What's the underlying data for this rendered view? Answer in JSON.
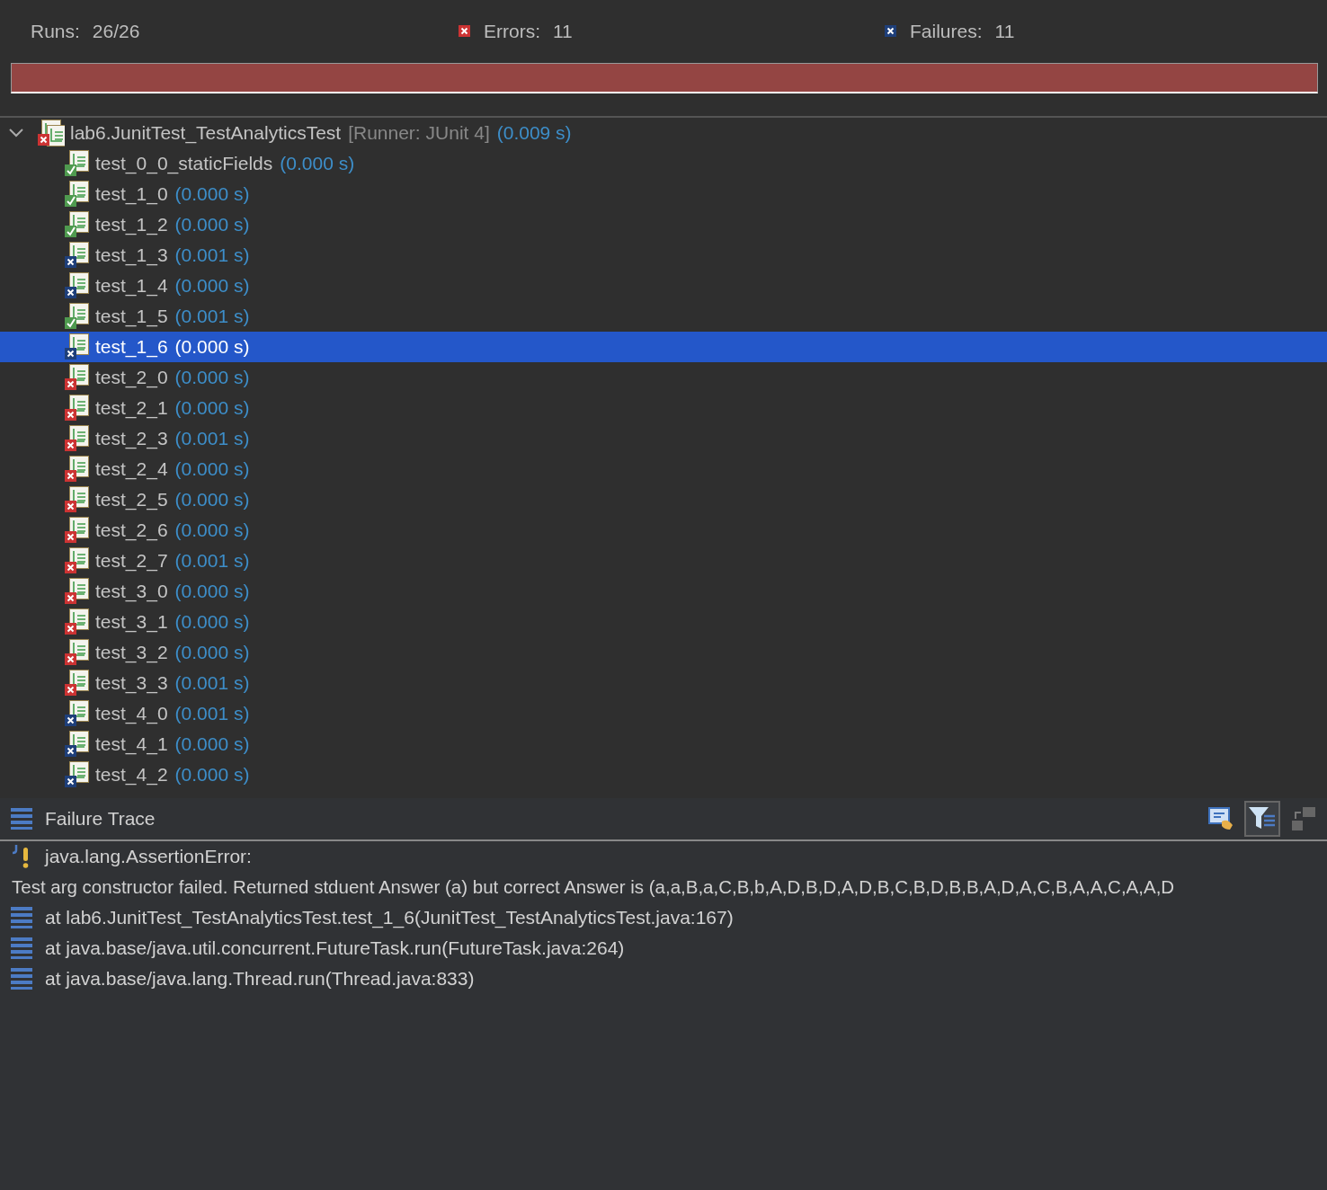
{
  "summary": {
    "runs_label": "Runs:",
    "runs": "26/26",
    "errors_label": "Errors:",
    "errors": "11",
    "failures_label": "Failures:",
    "failures": "11"
  },
  "progress": {
    "level": 1,
    "failed": true
  },
  "tree": {
    "suite": {
      "name": "lab6.JunitTest_TestAnalyticsTest",
      "runner": "[Runner: JUnit 4]",
      "time": "(0.009 s)",
      "kind": "error",
      "expanded": true
    },
    "tests": [
      {
        "name": "test_0_0_staticFields",
        "time": "(0.000 s)",
        "kind": "pass",
        "selected": false
      },
      {
        "name": "test_1_0",
        "time": "(0.000 s)",
        "kind": "pass",
        "selected": false
      },
      {
        "name": "test_1_2",
        "time": "(0.000 s)",
        "kind": "pass",
        "selected": false
      },
      {
        "name": "test_1_3",
        "time": "(0.001 s)",
        "kind": "failure",
        "selected": false
      },
      {
        "name": "test_1_4",
        "time": "(0.000 s)",
        "kind": "failure",
        "selected": false
      },
      {
        "name": "test_1_5",
        "time": "(0.001 s)",
        "kind": "pass",
        "selected": false
      },
      {
        "name": "test_1_6",
        "time": "(0.000 s)",
        "kind": "failure",
        "selected": true
      },
      {
        "name": "test_2_0",
        "time": "(0.000 s)",
        "kind": "error",
        "selected": false
      },
      {
        "name": "test_2_1",
        "time": "(0.000 s)",
        "kind": "error",
        "selected": false
      },
      {
        "name": "test_2_3",
        "time": "(0.001 s)",
        "kind": "error",
        "selected": false
      },
      {
        "name": "test_2_4",
        "time": "(0.000 s)",
        "kind": "error",
        "selected": false
      },
      {
        "name": "test_2_5",
        "time": "(0.000 s)",
        "kind": "error",
        "selected": false
      },
      {
        "name": "test_2_6",
        "time": "(0.000 s)",
        "kind": "error",
        "selected": false
      },
      {
        "name": "test_2_7",
        "time": "(0.001 s)",
        "kind": "error",
        "selected": false
      },
      {
        "name": "test_3_0",
        "time": "(0.000 s)",
        "kind": "error",
        "selected": false
      },
      {
        "name": "test_3_1",
        "time": "(0.000 s)",
        "kind": "error",
        "selected": false
      },
      {
        "name": "test_3_2",
        "time": "(0.000 s)",
        "kind": "error",
        "selected": false
      },
      {
        "name": "test_3_3",
        "time": "(0.001 s)",
        "kind": "error",
        "selected": false
      },
      {
        "name": "test_4_0",
        "time": "(0.001 s)",
        "kind": "failure",
        "selected": false
      },
      {
        "name": "test_4_1",
        "time": "(0.000 s)",
        "kind": "failure",
        "selected": false
      },
      {
        "name": "test_4_2",
        "time": "(0.000 s)",
        "kind": "failure",
        "selected": false
      }
    ]
  },
  "failure_trace": {
    "title": "Failure Trace",
    "filter_on": true,
    "lines": [
      {
        "kind": "exception",
        "text": "java.lang.AssertionError:"
      },
      {
        "kind": "message",
        "text": "Test arg constructor failed. Returned stduent Answer (a) but correct Answer is (a,a,B,a,C,B,b,A,D,B,D,A,D,B,C,B,D,B,B,A,D,A,C,B,A,A,C,A,A,D"
      },
      {
        "kind": "frame",
        "text": "at lab6.JunitTest_TestAnalyticsTest.test_1_6(JunitTest_TestAnalyticsTest.java:167)"
      },
      {
        "kind": "frame",
        "text": "at java.base/java.util.concurrent.FutureTask.run(FutureTask.java:264)"
      },
      {
        "kind": "frame",
        "text": "at java.base/java.lang.Thread.run(Thread.java:833)"
      }
    ]
  }
}
